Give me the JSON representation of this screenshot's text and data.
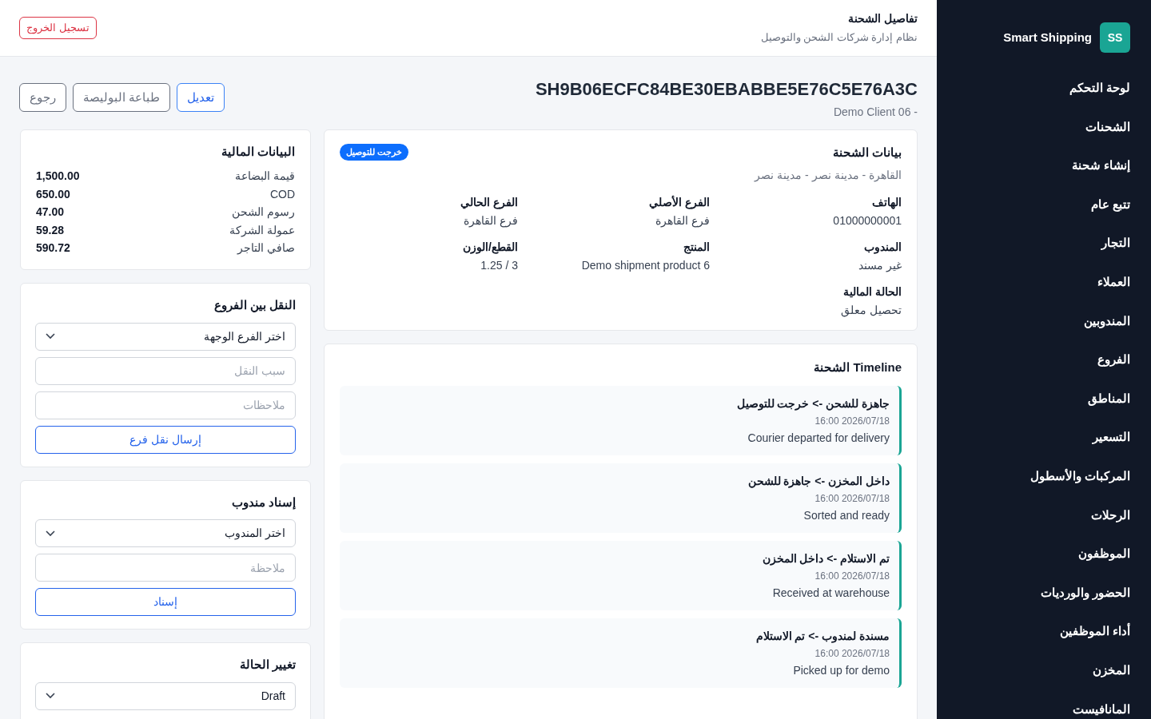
{
  "header": {
    "title": "تفاصيل الشحنة",
    "subtitle": "نظام إدارة شركات الشحن والتوصيل",
    "logout_button": "تسجيل الخروج"
  },
  "brand": {
    "initials": "SS",
    "name": "Smart Shipping"
  },
  "sidebar": {
    "items": [
      {
        "label": "لوحة التحكم"
      },
      {
        "label": "الشحنات"
      },
      {
        "label": "إنشاء شحنة"
      },
      {
        "label": "تتبع عام"
      },
      {
        "label": "التجار"
      },
      {
        "label": "العملاء"
      },
      {
        "label": "المندوبين"
      },
      {
        "label": "الفروع"
      },
      {
        "label": "المناطق"
      },
      {
        "label": "التسعير"
      },
      {
        "label": "المركبات والأسطول"
      },
      {
        "label": "الرحلات"
      },
      {
        "label": "الموظفون"
      },
      {
        "label": "الحضور والورديات"
      },
      {
        "label": "أداء الموظفين"
      },
      {
        "label": "المخزن"
      },
      {
        "label": "المانافيست"
      }
    ]
  },
  "shipment": {
    "code": "SH9B06ECFC84BE30EBABBE5E76C5E76A3C",
    "client": "Demo Client 06 -",
    "actions": [
      {
        "label": "تعديل",
        "kind": "primary"
      },
      {
        "label": "طباعة البوليصة",
        "kind": "secondary"
      },
      {
        "label": "رجوع",
        "kind": "secondary"
      }
    ]
  },
  "details": {
    "title": "بيانات الشحنة",
    "badge": {
      "label": "خرجت للتوصيل",
      "color": "#0d6efd"
    },
    "address": "القاهرة - مدينة نصر - مدينة نصر",
    "fields": [
      {
        "label": "الهاتف",
        "value": "01000000001"
      },
      {
        "label": "الفرع الأصلي",
        "value": "فرع القاهرة"
      },
      {
        "label": "الفرع الحالي",
        "value": "فرع القاهرة"
      },
      {
        "label": "المندوب",
        "value": "غير مسند"
      },
      {
        "label": "المنتج",
        "value": "Demo shipment product 6"
      },
      {
        "label": "القطع/الوزن",
        "value": "1.25 / 3"
      },
      {
        "label": "الحالة المالية",
        "value": "تحصيل معلق"
      }
    ]
  },
  "timeline": {
    "title": "Timeline الشحنة",
    "events": [
      {
        "title": "جاهزة للشحن -> خرجت للتوصيل",
        "time": "16:00 2026/07/18",
        "note": "Courier departed for delivery"
      },
      {
        "title": "داخل المخزن -> جاهزة للشحن",
        "time": "16:00 2026/07/18",
        "note": "Sorted and ready"
      },
      {
        "title": "تم الاستلام -> داخل المخزن",
        "time": "16:00 2026/07/18",
        "note": "Received at warehouse"
      },
      {
        "title": "مسندة لمندوب -> تم الاستلام",
        "time": "16:00 2026/07/18",
        "note": "Picked up for demo"
      }
    ]
  },
  "financial": {
    "title": "البيانات المالية",
    "rows": [
      {
        "label": "قيمة البضاعة",
        "value": "1,500.00"
      },
      {
        "label": "COD",
        "value": "650.00"
      },
      {
        "label": "رسوم الشحن",
        "value": "47.00"
      },
      {
        "label": "عمولة الشركة",
        "value": "59.28"
      },
      {
        "label": "صافي التاجر",
        "value": "590.72"
      }
    ]
  },
  "forms": [
    {
      "title": "النقل بين الفروع",
      "controls": [
        {
          "kind": "select",
          "value": "اختر الفرع الوجهة"
        },
        {
          "kind": "input",
          "placeholder": "سبب النقل"
        },
        {
          "kind": "input",
          "placeholder": "ملاحظات"
        },
        {
          "kind": "button",
          "label": "إرسال نقل فرع"
        }
      ]
    },
    {
      "title": "إسناد مندوب",
      "controls": [
        {
          "kind": "select",
          "value": "اختر المندوب"
        },
        {
          "kind": "input",
          "placeholder": "ملاحظة"
        },
        {
          "kind": "button",
          "label": "إسناد"
        }
      ]
    },
    {
      "title": "تغيير الحالة",
      "controls": [
        {
          "kind": "select",
          "value": "Draft"
        }
      ]
    }
  ]
}
